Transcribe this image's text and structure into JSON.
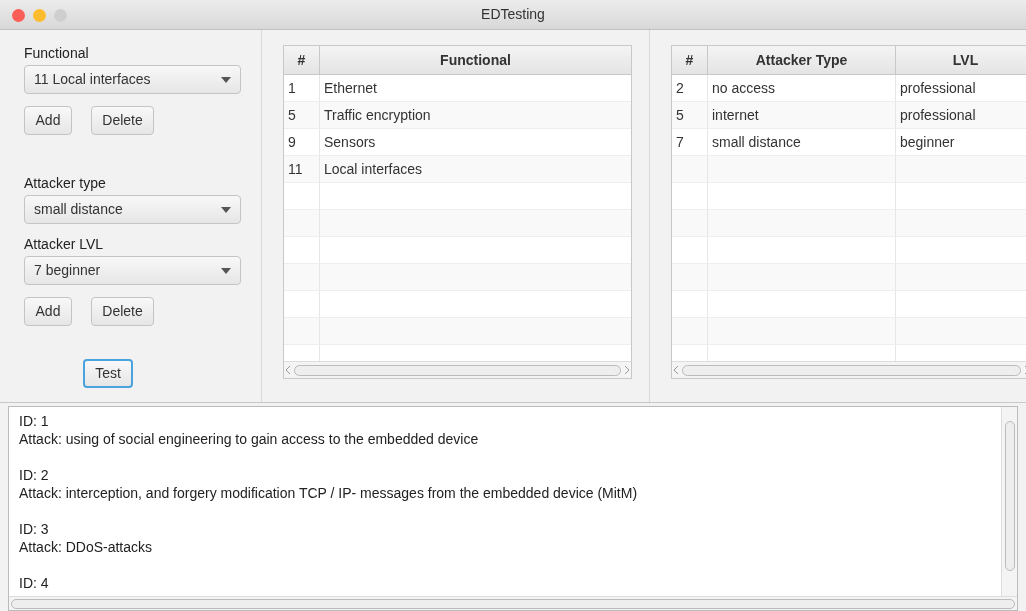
{
  "window": {
    "title": "EDTesting"
  },
  "form": {
    "functional_label": "Functional",
    "functional_value": "11 Local interfaces",
    "add_1": "Add",
    "delete_1": "Delete",
    "attacker_type_label": "Attacker type",
    "attacker_type_value": "small distance",
    "attacker_lvl_label": "Attacker LVL",
    "attacker_lvl_value": "7 beginner",
    "add_2": "Add",
    "delete_2": "Delete",
    "test_button": {
      "label": "Test",
      "focused": true
    }
  },
  "functional_table": {
    "columns": [
      "#",
      "Functional"
    ],
    "rows": [
      [
        "1",
        "Ethernet"
      ],
      [
        "5",
        "Traffic encryption"
      ],
      [
        "9",
        "Sensors"
      ],
      [
        "11",
        "Local interfaces"
      ]
    ]
  },
  "attacker_table": {
    "columns": [
      "#",
      "Attacker Type",
      "LVL"
    ],
    "rows": [
      [
        "2",
        "no access",
        "professional"
      ],
      [
        "5",
        "internet",
        "professional"
      ],
      [
        "7",
        "small distance",
        "beginner"
      ]
    ]
  },
  "output": {
    "entries": [
      {
        "lines": [
          "ID: 1",
          "Attack: using of social engineering to gain access to the embedded device"
        ]
      },
      {
        "lines": [
          "ID: 2",
          "Attack: interception, and forgery modification TCP / IP- messages from the embedded device (MitM)"
        ]
      },
      {
        "lines": [
          "ID: 3",
          "Attack: DDoS-attacks"
        ]
      },
      {
        "lines": [
          "ID: 4"
        ]
      }
    ]
  }
}
